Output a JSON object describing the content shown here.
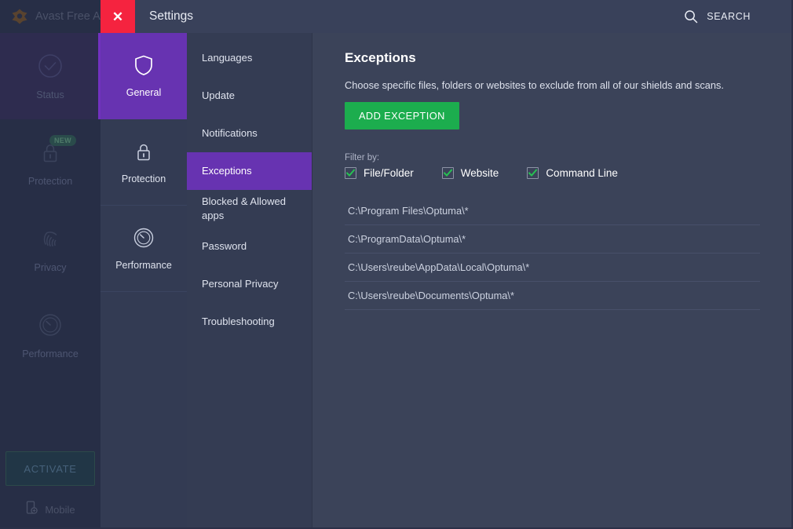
{
  "titlebar": {
    "brand": "Avast Free A",
    "brand_icon": "avast-logo-icon",
    "close_icon": "close-icon",
    "close_label": "✕",
    "title": "Settings",
    "search_label": "SEARCH",
    "search_icon": "search-icon"
  },
  "primary_nav": {
    "items": [
      {
        "label": "Status",
        "icon": "check-circle-icon",
        "active": true,
        "badge": ""
      },
      {
        "label": "Protection",
        "icon": "lock-icon",
        "active": false,
        "badge": "NEW"
      },
      {
        "label": "Privacy",
        "icon": "fingerprint-icon",
        "active": false,
        "badge": ""
      },
      {
        "label": "Performance",
        "icon": "gauge-icon",
        "active": false,
        "badge": ""
      }
    ],
    "activate_label": "ACTIVATE",
    "mobile_label": "Mobile",
    "mobile_icon": "mobile-add-icon"
  },
  "settings_nav": {
    "items": [
      {
        "label": "General",
        "icon": "shield-icon",
        "active": true
      },
      {
        "label": "Protection",
        "icon": "lock-icon",
        "active": false
      },
      {
        "label": "Performance",
        "icon": "gauge-icon",
        "active": false
      }
    ]
  },
  "sub_nav": {
    "items": [
      {
        "label": "Languages",
        "active": false
      },
      {
        "label": "Update",
        "active": false
      },
      {
        "label": "Notifications",
        "active": false
      },
      {
        "label": "Exceptions",
        "active": true
      },
      {
        "label": "Blocked & Allowed apps",
        "active": false
      },
      {
        "label": "Password",
        "active": false
      },
      {
        "label": "Personal Privacy",
        "active": false
      },
      {
        "label": "Troubleshooting",
        "active": false
      }
    ]
  },
  "main": {
    "title": "Exceptions",
    "description": "Choose specific files, folders or websites to exclude from all of our shields and scans.",
    "add_button": "ADD EXCEPTION",
    "filter_label": "Filter by:",
    "filters": [
      {
        "label": "File/Folder",
        "checked": true
      },
      {
        "label": "Website",
        "checked": true
      },
      {
        "label": "Command Line",
        "checked": true
      }
    ],
    "exceptions": [
      "C:\\Program Files\\Optuma\\*",
      "C:\\ProgramData\\Optuma\\*",
      "C:\\Users\\reube\\AppData\\Local\\Optuma\\*",
      "C:\\Users\\reube\\Documents\\Optuma\\*"
    ]
  },
  "colors": {
    "accent_purple": "#6733b1",
    "close_red": "#f5233f",
    "add_green": "#1cad4e",
    "panel_bg": "#3b4359",
    "sidebar_bg": "#272e46"
  }
}
